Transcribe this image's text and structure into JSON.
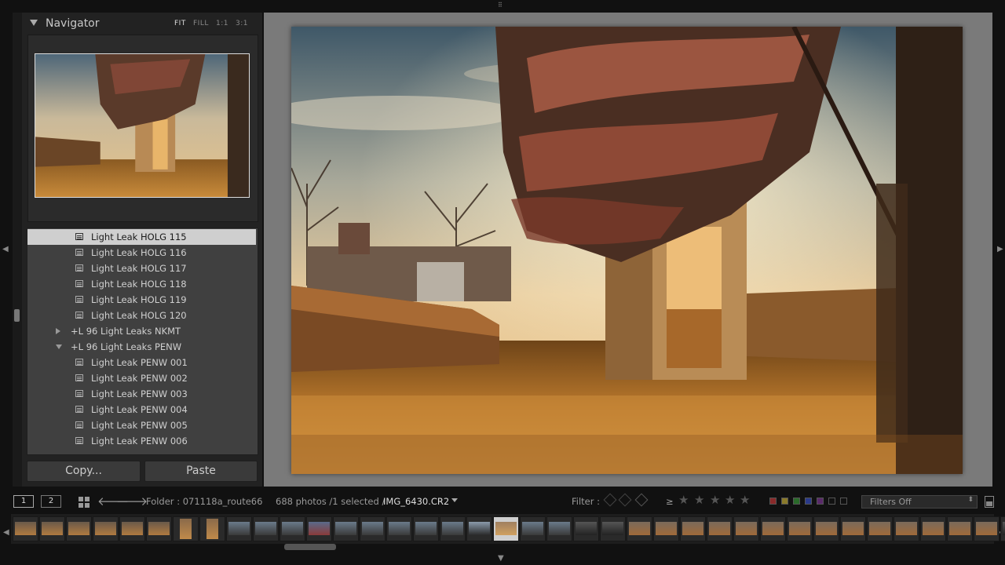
{
  "navigator": {
    "title": "Navigator",
    "zoom_options": [
      "FIT",
      "FILL",
      "1:1",
      "3:1"
    ],
    "active_zoom": "FIT"
  },
  "presets": [
    {
      "label": "Light Leak HOLG 115",
      "type": "preset",
      "selected": true
    },
    {
      "label": "Light Leak HOLG 116",
      "type": "preset"
    },
    {
      "label": "Light Leak HOLG 117",
      "type": "preset"
    },
    {
      "label": "Light Leak HOLG 118",
      "type": "preset"
    },
    {
      "label": "Light Leak HOLG 119",
      "type": "preset"
    },
    {
      "label": "Light Leak HOLG 120",
      "type": "preset"
    },
    {
      "label": "+L 96 Light Leaks NKMT",
      "type": "folder",
      "expanded": false
    },
    {
      "label": "+L 96 Light Leaks PENW",
      "type": "folder",
      "expanded": true
    },
    {
      "label": "Light Leak PENW 001",
      "type": "preset"
    },
    {
      "label": "Light Leak PENW 002",
      "type": "preset"
    },
    {
      "label": "Light Leak PENW 003",
      "type": "preset"
    },
    {
      "label": "Light Leak PENW 004",
      "type": "preset"
    },
    {
      "label": "Light Leak PENW 005",
      "type": "preset"
    },
    {
      "label": "Light Leak PENW 006",
      "type": "preset"
    }
  ],
  "buttons": {
    "copy": "Copy...",
    "paste": "Paste"
  },
  "status": {
    "page1": "1",
    "page2": "2",
    "folder": "Folder : 071118a_route66",
    "count": "688 photos /1 selected /",
    "filename": "IMG_6430.CR2",
    "filter_label": "Filter :",
    "rating_op": "≥",
    "filters_off": "Filters Off"
  },
  "colors": {
    "label_red": "#8a2a2a",
    "label_yellow": "#8a7a2a",
    "label_green": "#2a6a2a",
    "label_blue": "#2a3a8a",
    "label_purple": "#5a2a6a"
  },
  "filmstrip": [
    "warm",
    "warm",
    "warm",
    "warm",
    "warm",
    "warm",
    "portrait-warm",
    "portrait-warm",
    "cool",
    "cool",
    "cool",
    "flag",
    "cool",
    "cool",
    "cool",
    "cool",
    "cool",
    "sky",
    "selected",
    "cool",
    "cool",
    "dark",
    "dark",
    "amber",
    "amber",
    "amber",
    "amber",
    "amber",
    "amber",
    "amber",
    "amber",
    "amber",
    "amber",
    "amber",
    "amber",
    "amber",
    "amber",
    "dark"
  ]
}
